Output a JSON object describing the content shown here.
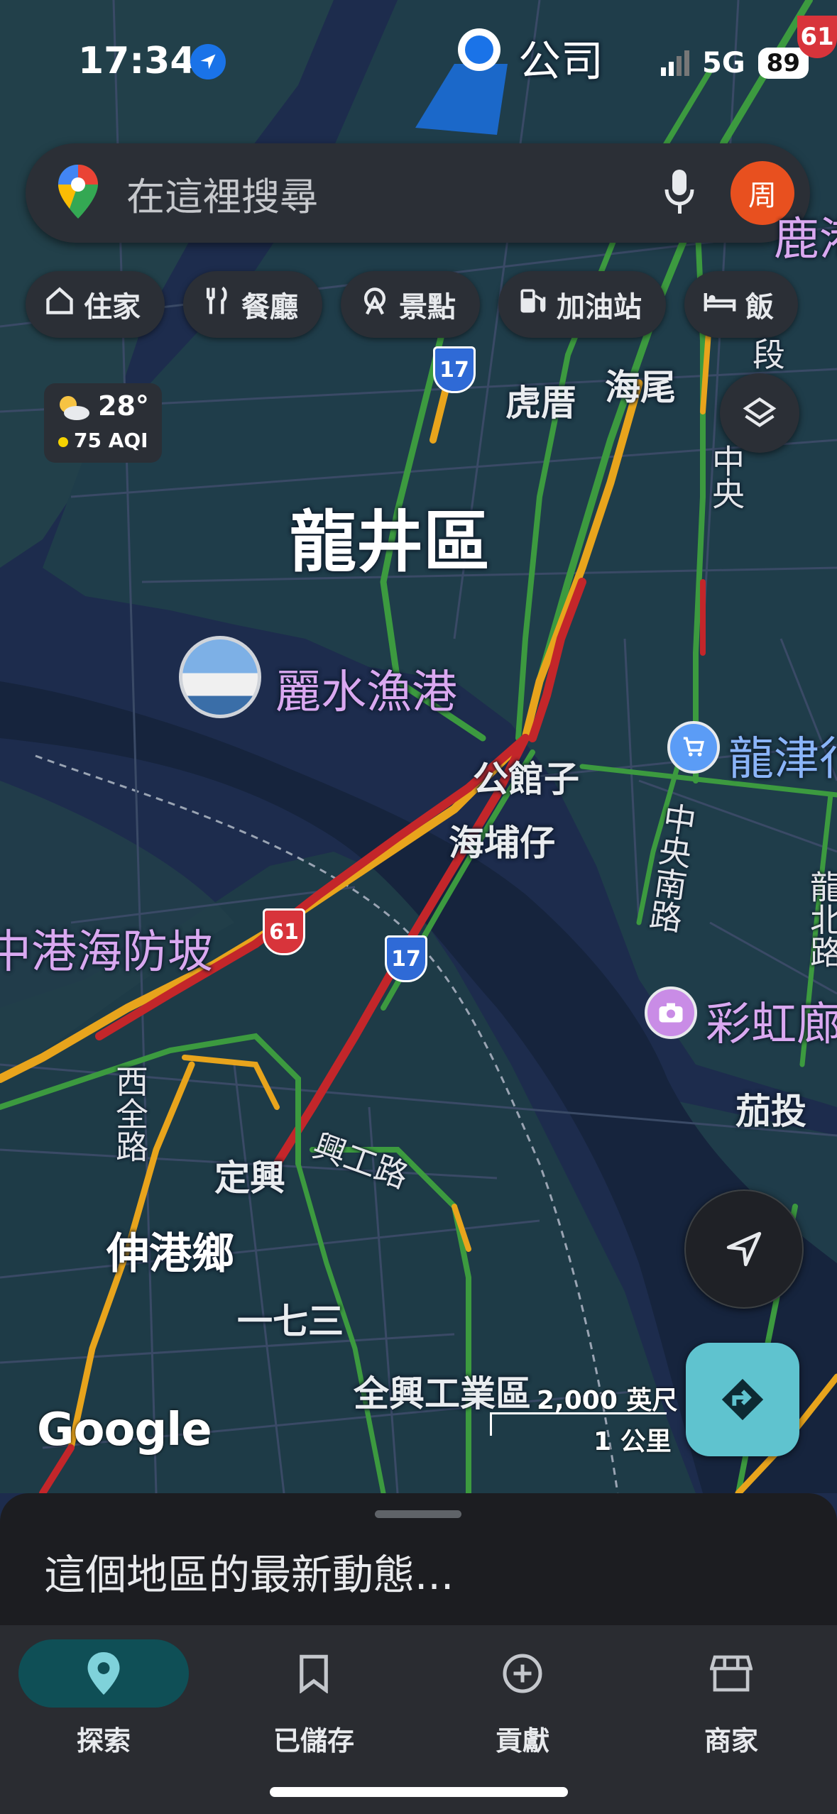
{
  "status": {
    "time": "17:34",
    "network": "5G",
    "battery": "89"
  },
  "shortcut_badge": {
    "label": "公司"
  },
  "search": {
    "placeholder": "在這裡搜尋",
    "avatar_letter": "周"
  },
  "chips": [
    {
      "label": "住家",
      "icon": "home-icon"
    },
    {
      "label": "餐廳",
      "icon": "restaurant-icon"
    },
    {
      "label": "景點",
      "icon": "attraction-icon"
    },
    {
      "label": "加油站",
      "icon": "gas-station-icon"
    },
    {
      "label": "飯",
      "icon": "hotel-icon"
    }
  ],
  "weather": {
    "temp": "28°",
    "aqi": "75 AQI"
  },
  "map": {
    "district": "龍井區",
    "township": "伸港鄉",
    "places": [
      "虎厝",
      "海尾",
      "公館子",
      "海埔仔",
      "定興",
      "一七三",
      "茄投",
      "全興工業區"
    ],
    "pois": [
      "麗水漁港",
      "中港海防坡",
      "彩虹廊"
    ],
    "shop_label": "龍津行",
    "roads": [
      "西全路",
      "興工路",
      "中央南路",
      "龍北路",
      "中央",
      "段"
    ],
    "road_shields": [
      "17",
      "61",
      "17",
      "61"
    ],
    "top_right_label": "鹿港"
  },
  "scale": {
    "imperial": "2,000 英尺",
    "metric": "1 公里"
  },
  "attribution": "Google",
  "sheet": {
    "title": "這個地區的最新動態..."
  },
  "nav": [
    {
      "label": "探索",
      "icon": "explore-pin-icon",
      "active": true
    },
    {
      "label": "已儲存",
      "icon": "bookmark-icon",
      "active": false
    },
    {
      "label": "貢獻",
      "icon": "plus-circle-icon",
      "active": false
    },
    {
      "label": "商家",
      "icon": "storefront-icon",
      "active": false
    }
  ],
  "colors": {
    "traffic_green": "#3c9a3f",
    "traffic_orange": "#e8a41c",
    "traffic_red": "#c3262a",
    "accent": "#7fd2da",
    "directions_button": "#5fc3cf",
    "avatar": "#e8501f"
  }
}
